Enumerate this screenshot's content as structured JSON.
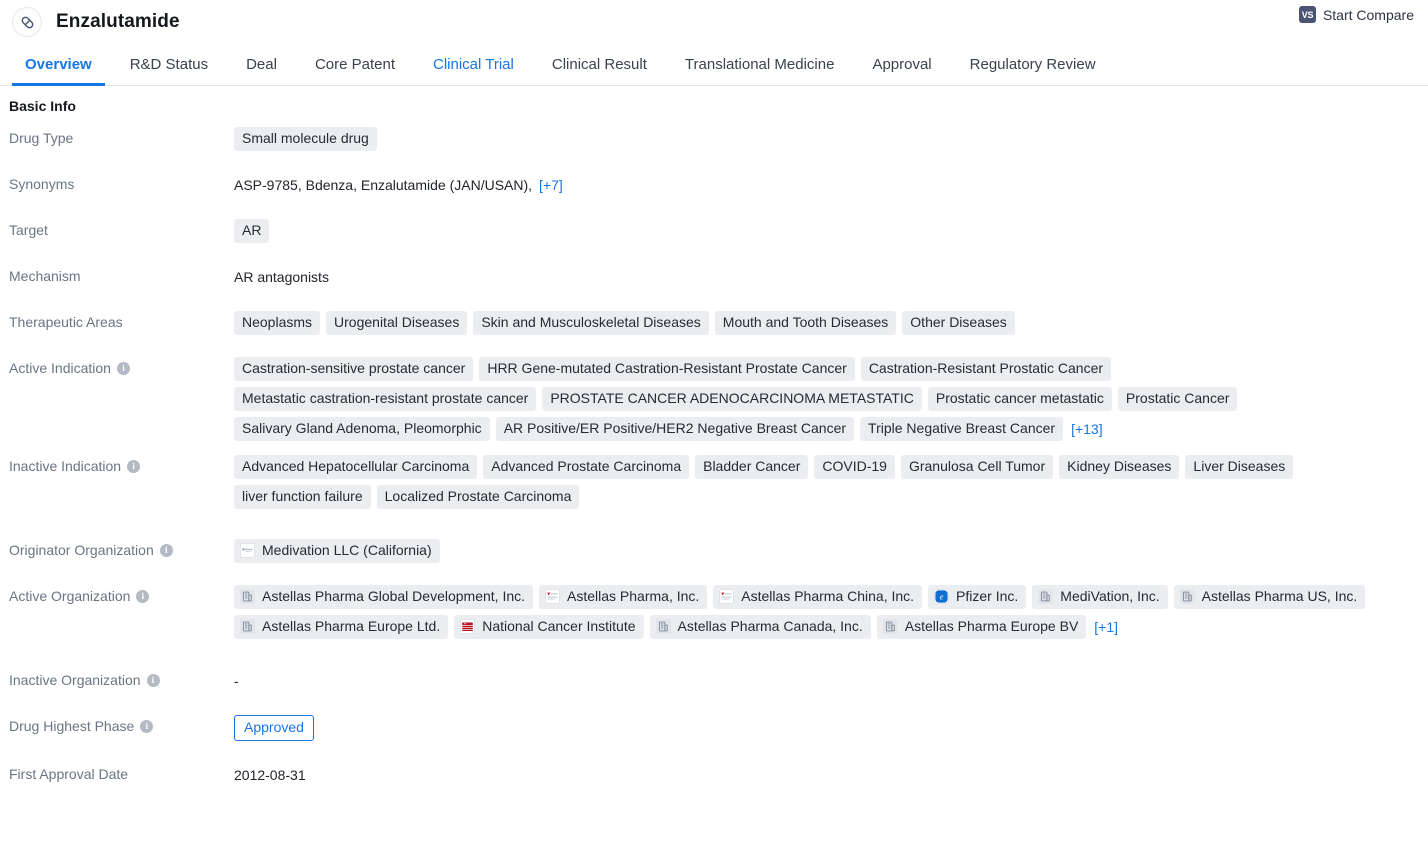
{
  "header": {
    "drug_name": "Enzalutamide",
    "drug_icon": "capsule-icon",
    "compare_badge": "VS",
    "compare_label": "Start Compare"
  },
  "tabs": [
    {
      "label": "Overview",
      "state": "active"
    },
    {
      "label": "R&D Status",
      "state": "normal"
    },
    {
      "label": "Deal",
      "state": "normal"
    },
    {
      "label": "Core Patent",
      "state": "normal"
    },
    {
      "label": "Clinical Trial",
      "state": "link"
    },
    {
      "label": "Clinical Result",
      "state": "normal"
    },
    {
      "label": "Translational Medicine",
      "state": "normal"
    },
    {
      "label": "Approval",
      "state": "normal"
    },
    {
      "label": "Regulatory Review",
      "state": "normal"
    }
  ],
  "section": {
    "title": "Basic Info"
  },
  "labels": {
    "drug_type": "Drug Type",
    "synonyms": "Synonyms",
    "target": "Target",
    "mechanism": "Mechanism",
    "therapeutic_areas": "Therapeutic Areas",
    "active_indication": "Active Indication",
    "inactive_indication": "Inactive Indication",
    "originator_organization": "Originator Organization",
    "active_organization": "Active Organization",
    "inactive_organization": "Inactive Organization",
    "drug_highest_phase": "Drug Highest Phase",
    "first_approval_date": "First Approval Date"
  },
  "values": {
    "drug_type": [
      "Small molecule drug"
    ],
    "synonyms": {
      "text": "ASP-9785,  Bdenza,  Enzalutamide (JAN/USAN),",
      "more": "[+7]"
    },
    "target": [
      "AR"
    ],
    "mechanism": "AR antagonists",
    "therapeutic_areas": [
      "Neoplasms",
      "Urogenital Diseases",
      "Skin and Musculoskeletal Diseases",
      "Mouth and Tooth Diseases",
      "Other Diseases"
    ],
    "active_indication": {
      "items": [
        "Castration-sensitive prostate cancer",
        "HRR Gene-mutated Castration-Resistant Prostate Cancer",
        "Castration-Resistant Prostatic Cancer",
        "Metastatic castration-resistant prostate cancer",
        "PROSTATE CANCER ADENOCARCINOMA METASTATIC",
        "Prostatic cancer metastatic",
        "Prostatic Cancer",
        "Salivary Gland Adenoma, Pleomorphic",
        "AR Positive/ER Positive/HER2 Negative Breast Cancer",
        "Triple Negative Breast Cancer"
      ],
      "more": "[+13]"
    },
    "inactive_indication": {
      "items": [
        "Advanced Hepatocellular Carcinoma",
        "Advanced Prostate Carcinoma",
        "Bladder Cancer",
        "COVID-19",
        "Granulosa Cell Tumor",
        "Kidney Diseases",
        "Liver Diseases",
        "liver function failure",
        "Localized Prostate Carcinoma"
      ]
    },
    "originator_organization": [
      {
        "name": "Medivation LLC (California)",
        "logo": "medivation-logo"
      }
    ],
    "active_organization": {
      "items": [
        {
          "name": "Astellas Pharma Global Development, Inc.",
          "logo": "building-icon"
        },
        {
          "name": "Astellas Pharma, Inc.",
          "logo": "astellas-logo"
        },
        {
          "name": "Astellas Pharma China, Inc.",
          "logo": "astellas-logo"
        },
        {
          "name": "Pfizer Inc.",
          "logo": "pfizer-logo"
        },
        {
          "name": "MediVation, Inc.",
          "logo": "building-icon"
        },
        {
          "name": "Astellas Pharma US, Inc.",
          "logo": "building-icon"
        },
        {
          "name": "Astellas Pharma Europe Ltd.",
          "logo": "building-icon"
        },
        {
          "name": "National Cancer Institute",
          "logo": "nci-logo"
        },
        {
          "name": "Astellas Pharma Canada, Inc.",
          "logo": "building-icon"
        },
        {
          "name": "Astellas Pharma Europe BV",
          "logo": "building-icon"
        }
      ],
      "more": "[+1]"
    },
    "inactive_organization": "-",
    "drug_highest_phase": "Approved",
    "first_approval_date": "2012-08-31"
  },
  "colors": {
    "accent": "#1577e6",
    "tag_bg": "#ebedf0",
    "label": "#6a7583",
    "title": "#15181d"
  }
}
